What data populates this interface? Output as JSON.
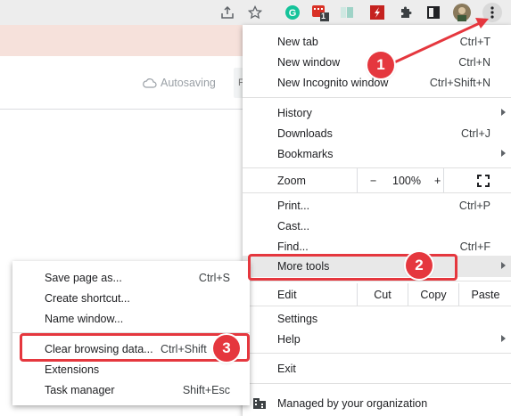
{
  "page": {
    "autosave_label": "Autosaving",
    "partial_button_letter": "F"
  },
  "toolbar": {
    "icons": [
      "share-icon",
      "star-icon",
      "grammarly-icon",
      "extension-badge-icon",
      "extension-icon",
      "flash-icon",
      "puzzle-icon",
      "sidepanel-icon",
      "avatar",
      "kebab-menu-icon"
    ],
    "badge_count": "1"
  },
  "menu": {
    "items": {
      "new_tab": {
        "label": "New tab",
        "shortcut": "Ctrl+T"
      },
      "new_window": {
        "label": "New window",
        "shortcut": "Ctrl+N"
      },
      "incognito": {
        "label": "New Incognito window",
        "shortcut": "Ctrl+Shift+N"
      },
      "history": {
        "label": "History"
      },
      "downloads": {
        "label": "Downloads",
        "shortcut": "Ctrl+J"
      },
      "bookmarks": {
        "label": "Bookmarks"
      },
      "zoom": {
        "label": "Zoom",
        "minus": "−",
        "value": "100%",
        "plus": "+"
      },
      "print": {
        "label": "Print...",
        "shortcut": "Ctrl+P"
      },
      "cast": {
        "label": "Cast..."
      },
      "find": {
        "label": "Find...",
        "shortcut": "Ctrl+F"
      },
      "more_tools": {
        "label": "More tools"
      },
      "edit": {
        "label": "Edit",
        "cut": "Cut",
        "copy": "Copy",
        "paste": "Paste"
      },
      "settings": {
        "label": "Settings"
      },
      "help": {
        "label": "Help"
      },
      "exit": {
        "label": "Exit"
      },
      "managed": {
        "label": "Managed by your organization"
      }
    }
  },
  "submenu": {
    "items": {
      "save_page": {
        "label": "Save page as...",
        "shortcut": "Ctrl+S"
      },
      "create_shortcut": {
        "label": "Create shortcut..."
      },
      "name_window": {
        "label": "Name window..."
      },
      "clear_data": {
        "label": "Clear browsing data...",
        "shortcut": "Ctrl+Shift"
      },
      "extensions": {
        "label": "Extensions"
      },
      "task_manager": {
        "label": "Task manager",
        "shortcut": "Shift+Esc"
      }
    }
  },
  "annotations": {
    "step1": "1",
    "step2": "2",
    "step3": "3",
    "color": "#e5373e"
  }
}
